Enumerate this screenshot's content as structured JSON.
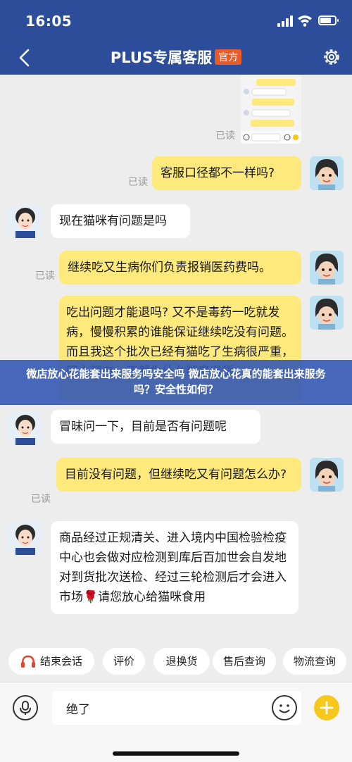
{
  "status_bar": {
    "time": "16:05"
  },
  "header": {
    "title": "PLUS专属客服",
    "badge": "官方"
  },
  "messages": {
    "read_label": "已读",
    "m1": "客服口径都不一样吗?",
    "m2": "现在猫咪有问题是吗",
    "m3": "继续吃又生病你们负责报销医药费吗。",
    "m4": "吃出问题才能退吗? 又不是毒药一吃就发病，慢慢积累的谁能保证继续吃没有问题。而且我这个批次已经有猫吃了生病很严重，网上都有，不然为什么都来退货",
    "m5": "冒昧问一下，目前是否有问题呢",
    "m6": "目前没有问题，但继续吃又有问题怎么办?",
    "m7": "商品经过正规清关、进入境内中国检验检疫中心也会做对应检测到库后百加世会自发地对到货批次送检、经过三轮检测后才会进入市场🌹请您放心给猫咪食用"
  },
  "banner": {
    "text": "微店放心花能套出来服务吗安全吗 微店放心花真的能套出来服务吗？安全性如何？"
  },
  "quick_actions": [
    "结束会话",
    "评价",
    "退换货",
    "售后查询",
    "物流查询"
  ],
  "input": {
    "value": "绝了"
  },
  "icons": {
    "back": "chevron-left-icon",
    "settings": "gear-icon",
    "headset": "headset-icon",
    "voice": "microphone-icon",
    "emoji": "emoji-icon",
    "plus": "plus-icon"
  },
  "colors": {
    "header": "#2c4d99",
    "my_bubble": "#fde97c",
    "badge": "#e85b2a",
    "plus": "#f7c71c",
    "headset": "#e8432f"
  }
}
